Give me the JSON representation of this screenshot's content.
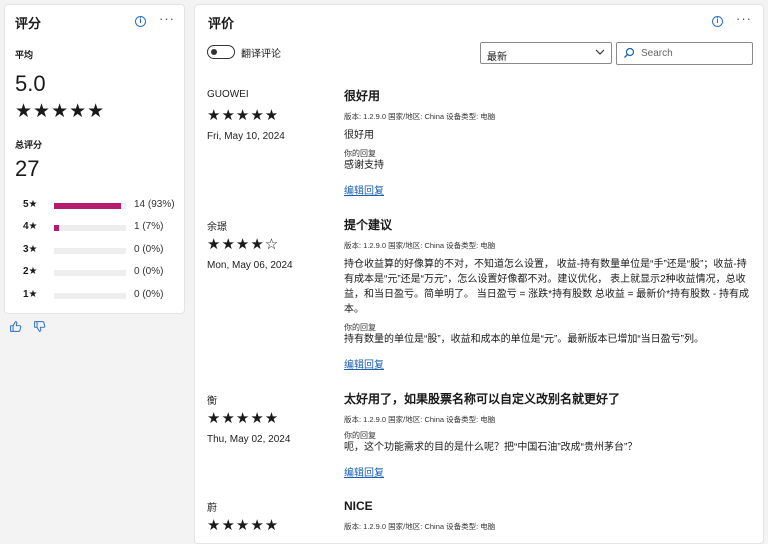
{
  "summary": {
    "title": "评分",
    "average_label": "平均",
    "average_value": "5.0",
    "average_stars": "★★★★★",
    "total_label": "总评分",
    "total_value": "27",
    "distribution": [
      {
        "star_label": "5★",
        "count_label": "14 (93%)",
        "fraction": 0.93
      },
      {
        "star_label": "4★",
        "count_label": "1 (7%)",
        "fraction": 0.07
      },
      {
        "star_label": "3★",
        "count_label": "0 (0%)",
        "fraction": 0
      },
      {
        "star_label": "2★",
        "count_label": "0 (0%)",
        "fraction": 0
      },
      {
        "star_label": "1★",
        "count_label": "0 (0%)",
        "fraction": 0
      }
    ]
  },
  "reviews_panel": {
    "title": "评价",
    "translate_label": "翻译评论",
    "sort_value": "最新",
    "search_placeholder": "Search"
  },
  "reviews": [
    {
      "author": "GUOWEI",
      "stars": "★★★★★",
      "date": "Fri, May 10, 2024",
      "title": "很好用",
      "meta": "版本: 1.2.9.0 国家/地区: China 设备类型: 电脑",
      "body": "很好用",
      "reply_label": "你的回复",
      "reply": "感谢支持",
      "edit_label": "编辑回复"
    },
    {
      "author": "余璟",
      "stars": "★★★★☆",
      "date": "Mon, May 06, 2024",
      "title": "提个建议",
      "meta": "版本: 1.2.9.0 国家/地区: China 设备类型: 电脑",
      "body": "持仓收益算的好像算的不对，不知道怎么设置， 收益-持有数量单位是“手”还是“股”；收益-持有成本是“元”还是“万元”，怎么设置好像都不对。建议优化， 表上就显示2种收益情况，总收益，和当日盈亏。简单明了。 当日盈亏 = 涨跌*持有股数 总收益 = 最新价*持有股数 - 持有成本。",
      "reply_label": "你的回复",
      "reply": "持有数量的单位是“股”，收益和成本的单位是“元”。最新版本已增加“当日盈亏”列。",
      "edit_label": "编辑回复"
    },
    {
      "author": "衡",
      "stars": "★★★★★",
      "date": "Thu, May 02, 2024",
      "title": "太好用了，如果股票名称可以自定义改别名就更好了",
      "meta": "版本: 1.2.9.0 国家/地区: China 设备类型: 电脑",
      "body": "",
      "reply_label": "你的回复",
      "reply": "呃，这个功能需求的目的是什么呢？把“中国石油”改成“贵州茅台”？",
      "edit_label": "编辑回复"
    },
    {
      "author": "蔚",
      "stars": "★★★★★",
      "date": "",
      "title": "NICE",
      "meta": "版本: 1.2.9.0 国家/地区: China 设备类型: 电脑",
      "body": "",
      "reply_label": "",
      "reply": "",
      "edit_label": ""
    }
  ],
  "colors": {
    "accent_bar": "#b51c6f",
    "link": "#1b5fb2",
    "info_icon": "#2c6fc7"
  },
  "icons": [
    "info-icon",
    "more-icon",
    "thumb-up-icon",
    "thumb-down-icon",
    "chevron-down-icon",
    "search-icon"
  ]
}
